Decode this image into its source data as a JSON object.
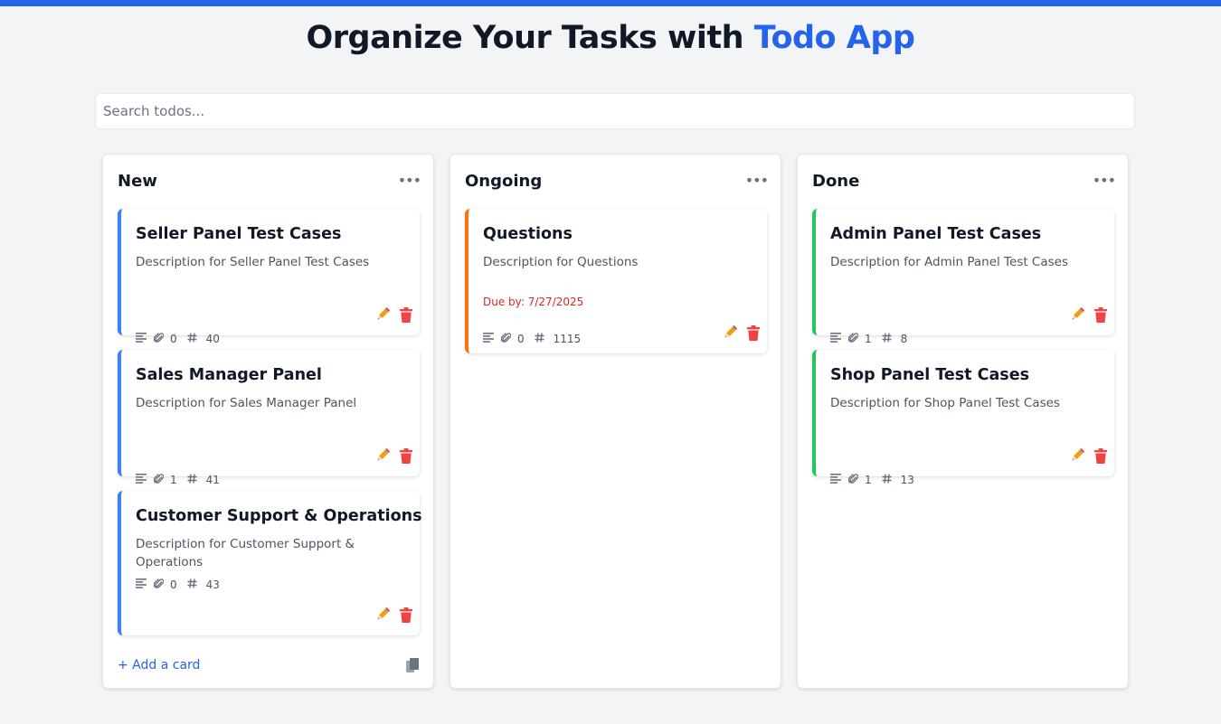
{
  "header": {
    "title_main": "Organize Your Tasks with",
    "title_accent": "Todo App"
  },
  "search": {
    "placeholder": "Search todos...",
    "value": ""
  },
  "colors": {
    "primary": "#2563eb",
    "new": "#3b82f6",
    "ongoing": "#f97316",
    "done": "#22c55e",
    "danger": "#dc2626"
  },
  "icons": {
    "column_menu": "ellipsis-icon",
    "description": "lines-icon",
    "attachments": "paperclip-icon",
    "id": "hash-icon",
    "edit": "pencil-icon",
    "delete": "trash-icon",
    "copy": "copy-icon"
  },
  "columns": [
    {
      "title": "New",
      "cards": [
        {
          "title": "Seller Panel Test Cases",
          "description": "Description for Seller Panel Test Cases",
          "attachments": "0",
          "id": "40"
        },
        {
          "title": "Sales Manager Panel",
          "description": "Description for Sales Manager Panel",
          "attachments": "1",
          "id": "41"
        },
        {
          "title": "Customer Support & Operations",
          "description": "Description for Customer Support & Operations",
          "attachments": "0",
          "id": "43"
        }
      ],
      "add_card_label": "+ Add a card"
    },
    {
      "title": "Ongoing",
      "cards": [
        {
          "title": "Questions",
          "description": "Description for Questions",
          "attachments": "0",
          "id": "1115",
          "due": "Due by: 7/27/2025"
        }
      ]
    },
    {
      "title": "Done",
      "cards": [
        {
          "title": "Admin Panel Test Cases",
          "description": "Description for Admin Panel Test Cases",
          "attachments": "1",
          "id": "8"
        },
        {
          "title": "Shop Panel Test Cases",
          "description": "Description for Shop Panel Test Cases",
          "attachments": "1",
          "id": "13"
        }
      ]
    }
  ]
}
